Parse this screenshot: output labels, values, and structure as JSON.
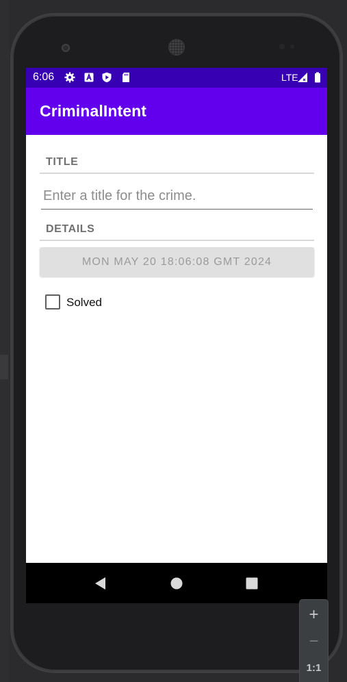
{
  "status_bar": {
    "time": "6:06",
    "network": "LTE",
    "icons": [
      "gear-icon",
      "a-icon",
      "shield-play-icon",
      "sd-card-icon",
      "signal-icon",
      "battery-icon"
    ]
  },
  "app_bar": {
    "title": "CriminalIntent"
  },
  "crime_form": {
    "title_section_label": "TITLE",
    "title_input_value": "",
    "title_input_placeholder": "Enter a title for the crime.",
    "details_section_label": "DETAILS",
    "date_button_label": "MON MAY 20 18:06:08 GMT 2024",
    "solved_label": "Solved",
    "solved_checked": false
  },
  "navigation_bar": {
    "buttons": [
      "back-icon",
      "home-icon",
      "recents-icon"
    ]
  },
  "emulator_zoom": {
    "zoom_in": "+",
    "zoom_out": "−",
    "actual_size": "1:1"
  },
  "colors": {
    "status_bar": "#3700b3",
    "app_bar": "#6200ee",
    "date_button_bg": "#e0e0e0",
    "nav_bar": "#000000"
  }
}
